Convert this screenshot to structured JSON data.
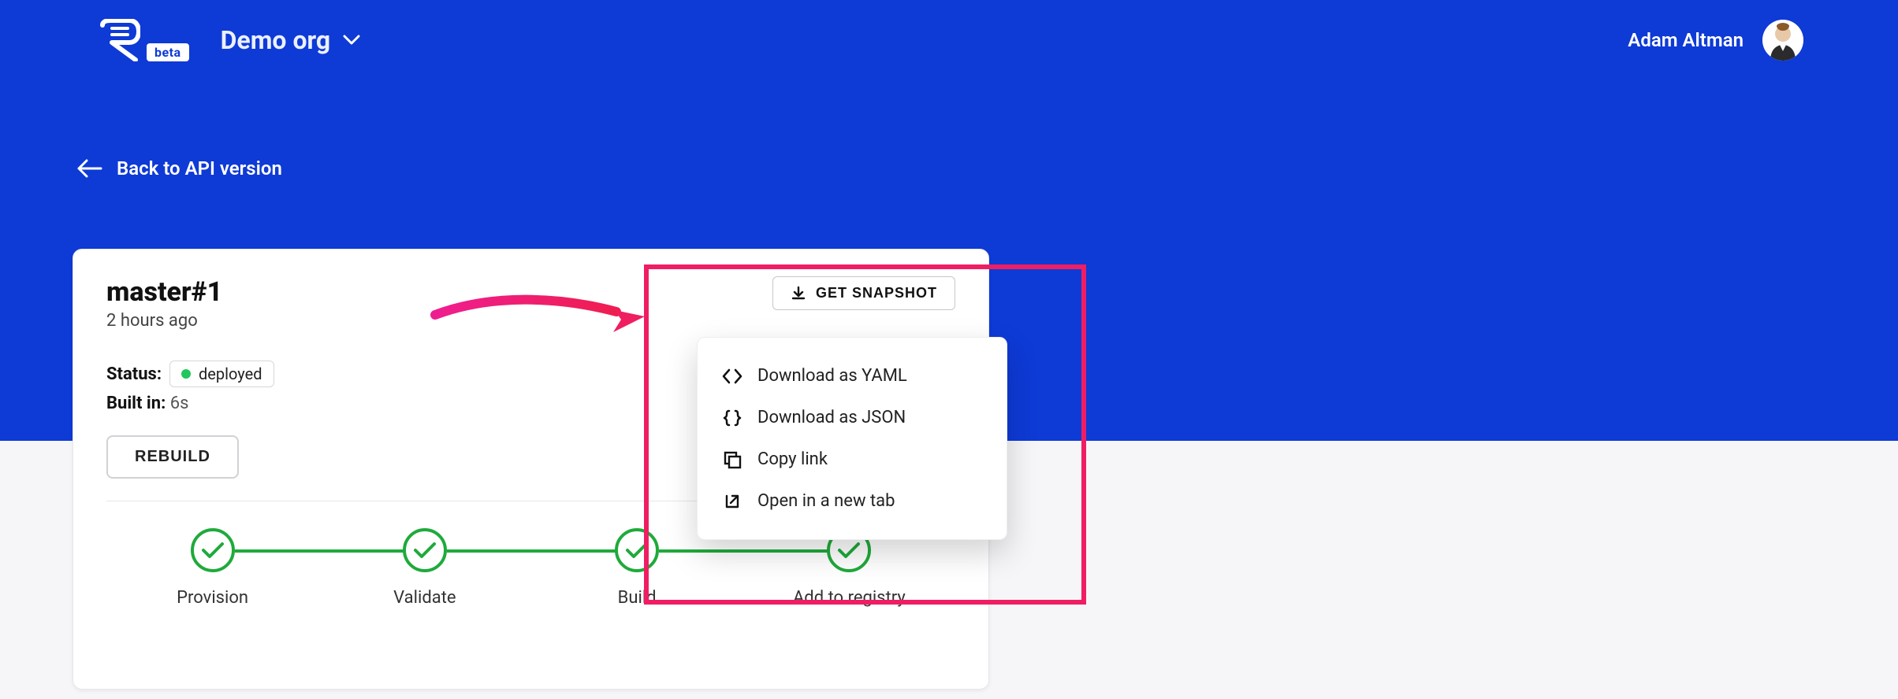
{
  "header": {
    "beta_label": "beta",
    "org_name": "Demo org",
    "user_name": "Adam Altman"
  },
  "back_link": {
    "label": "Back to API version"
  },
  "build": {
    "title": "master#1",
    "subtitle": "2 hours ago",
    "status_label": "Status:",
    "status_value": "deployed",
    "built_label": "Built in:",
    "built_value": "6s",
    "rebuild_label": "REBUILD",
    "snapshot_label": "GET SNAPSHOT"
  },
  "dropdown": {
    "items": [
      {
        "label": "Download as YAML"
      },
      {
        "label": "Download as JSON"
      },
      {
        "label": "Copy link"
      },
      {
        "label": "Open in a new tab"
      }
    ]
  },
  "steps": [
    {
      "label": "Provision"
    },
    {
      "label": "Validate"
    },
    {
      "label": "Build"
    },
    {
      "label": "Add to registry"
    }
  ]
}
